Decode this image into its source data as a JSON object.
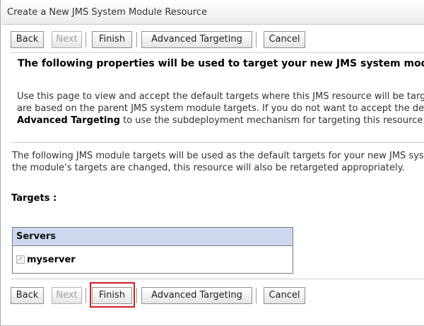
{
  "window": {
    "title": "Create a New JMS System Module Resource"
  },
  "buttons": {
    "back": "Back",
    "next": "Next",
    "finish": "Finish",
    "advanced_targeting": "Advanced Targeting",
    "cancel": "Cancel"
  },
  "content": {
    "heading": "The following properties will be used to target your new JMS system module resource",
    "intro": {
      "line1": "Use this page to view and accept the default targets where this JMS resource will be targeted. T",
      "line2": "are based on the parent JMS system module targets. If you do not want to accept the default",
      "line3_bold": "Advanced Targeting",
      "line3_rest": " to use the subdeployment mechanism for targeting this resource."
    },
    "module_targets": {
      "line1": "The following JMS module targets will be used as the default targets for your new JMS system m",
      "line2": "the module's targets are changed, this resource will also be retargeted appropriately."
    },
    "targets_label": "Targets :"
  },
  "servers_table": {
    "header": "Servers",
    "rows": [
      {
        "name": "myserver",
        "checked": true
      }
    ]
  },
  "icons": {
    "checkbox": "checkmark-icon"
  },
  "colors": {
    "highlight": "#cc1f1f",
    "table_header": "#ccd9ee"
  }
}
